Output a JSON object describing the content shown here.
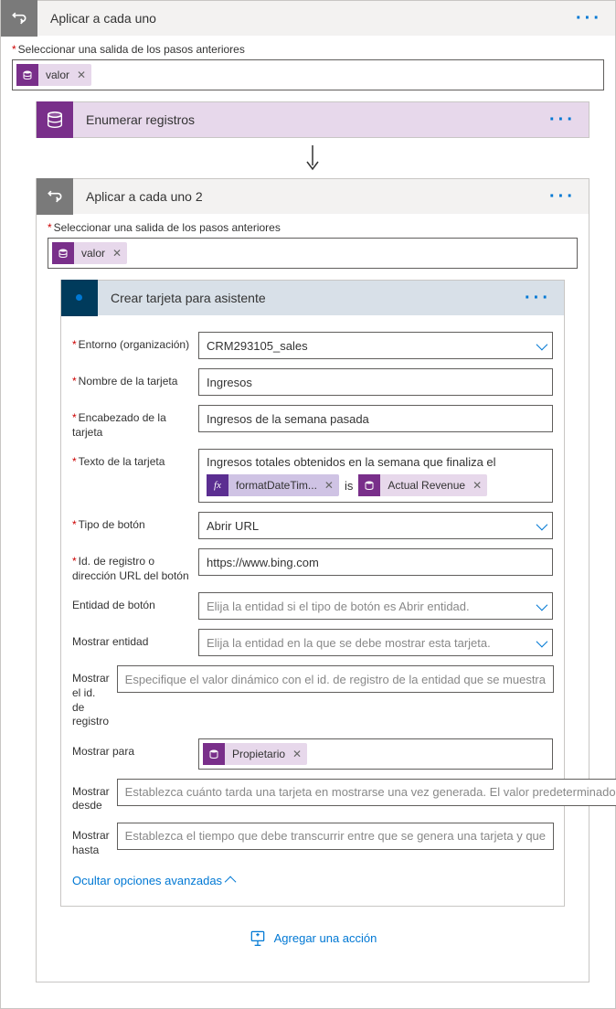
{
  "outer": {
    "title": "Aplicar a cada uno",
    "select_label": "Seleccionar una salida de los pasos anteriores",
    "token": "valor"
  },
  "enumerate": {
    "title": "Enumerar registros"
  },
  "inner": {
    "title": "Aplicar a cada uno 2",
    "select_label": "Seleccionar una salida de los pasos anteriores",
    "token": "valor"
  },
  "card": {
    "title": "Crear tarjeta para asistente",
    "fields": {
      "env_label": "Entorno (organización)",
      "env_value": "CRM293105_sales",
      "name_label": "Nombre de la tarjeta",
      "name_value": "Ingresos",
      "header_label": "Encabezado de la tarjeta",
      "header_value": "Ingresos de la semana pasada",
      "text_label": "Texto de la tarjeta",
      "text_value": "Ingresos totales obtenidos en la semana que finaliza el",
      "text_token_fx": "formatDateTim...",
      "text_sep": "is",
      "text_token_rev": "Actual Revenue",
      "btntype_label": "Tipo de botón",
      "btntype_value": "Abrir URL",
      "recid_label": "Id. de registro o dirección URL del botón",
      "recid_value": "https://www.bing.com",
      "btnentity_label": "Entidad de botón",
      "btnentity_placeholder": "Elija la entidad si el tipo de botón es Abrir entidad.",
      "showentity_label": "Mostrar entidad",
      "showentity_placeholder": "Elija la entidad en la que se debe mostrar esta tarjeta.",
      "showrec_label": "Mostrar el id. de registro",
      "showrec_placeholder": "Especifique el valor dinámico con el id. de registro de la entidad que se muestra",
      "showfor_label": "Mostrar para",
      "showfor_token": "Propietario",
      "showfrom_label": "Mostrar desde",
      "showfrom_placeholder": "Establezca cuánto tarda una tarjeta en mostrarse una vez generada. El valor predeterminado",
      "showto_label": "Mostrar hasta",
      "showto_placeholder": "Establezca el tiempo que debe transcurrir entre que se genera una tarjeta y que"
    },
    "advanced_toggle": "Ocultar opciones avanzadas"
  },
  "add_action": "Agregar una acción"
}
